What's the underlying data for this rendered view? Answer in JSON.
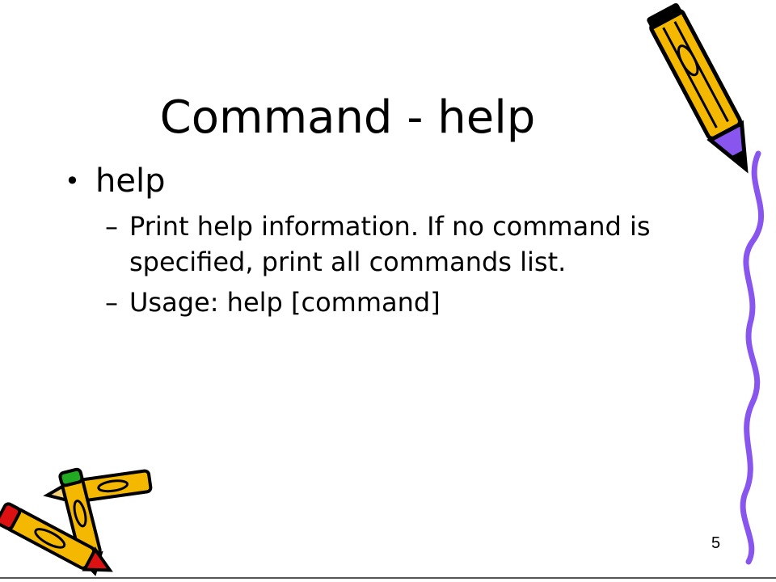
{
  "slide": {
    "title": "Command - help",
    "bullets": [
      {
        "bullet_glyph": "•",
        "text": "help",
        "sub": [
          {
            "dash": "–",
            "text": "Print help information. If no command is specified, print all commands list."
          },
          {
            "dash": "–",
            "text": "Usage: help [command]"
          }
        ]
      }
    ],
    "page_number": "5"
  },
  "decor": {
    "pencil_icon": "pencil-icon",
    "squiggle_icon": "purple-squiggle-line",
    "colors": {
      "pencil_yellow": "#F5B800",
      "pencil_outline": "#000000",
      "squiggle_purple": "#8855EE",
      "eraser_red": "#DD1111",
      "eraser_green": "#22AA22"
    }
  }
}
